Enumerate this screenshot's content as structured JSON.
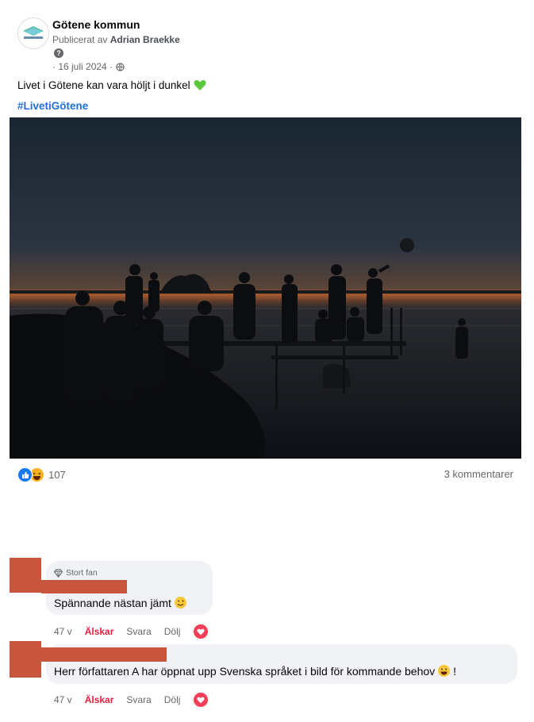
{
  "post": {
    "page_name": "Götene kommun",
    "published_prefix": "Publicerat av",
    "published_author": "Adrian Braekke",
    "date": "· 16 juli 2024 ·",
    "text": "Livet i Götene kan vara höljt i dunkel",
    "hashtag": "#LivetiGötene",
    "avatar_text": "Götene kommun"
  },
  "reactions": {
    "count": "107",
    "comments": "3 kommentarer"
  },
  "comments": [
    {
      "badge": "Stort fan",
      "text": "Spännande nästan jämt",
      "time": "47 v",
      "love": "Älskar",
      "reply": "Svara",
      "hide": "Dölj"
    },
    {
      "text": "Herr författaren A har öppnat upp Svenska språket i bild för kommande behov",
      "trailing": "!",
      "time": "47 v",
      "love": "Älskar",
      "reply": "Svara",
      "hide": "Dölj"
    }
  ],
  "colors": {
    "accent": "#1877f2",
    "hashtag": "#216fdb",
    "love": "#e41e3f",
    "redaction": "#c8553d"
  }
}
